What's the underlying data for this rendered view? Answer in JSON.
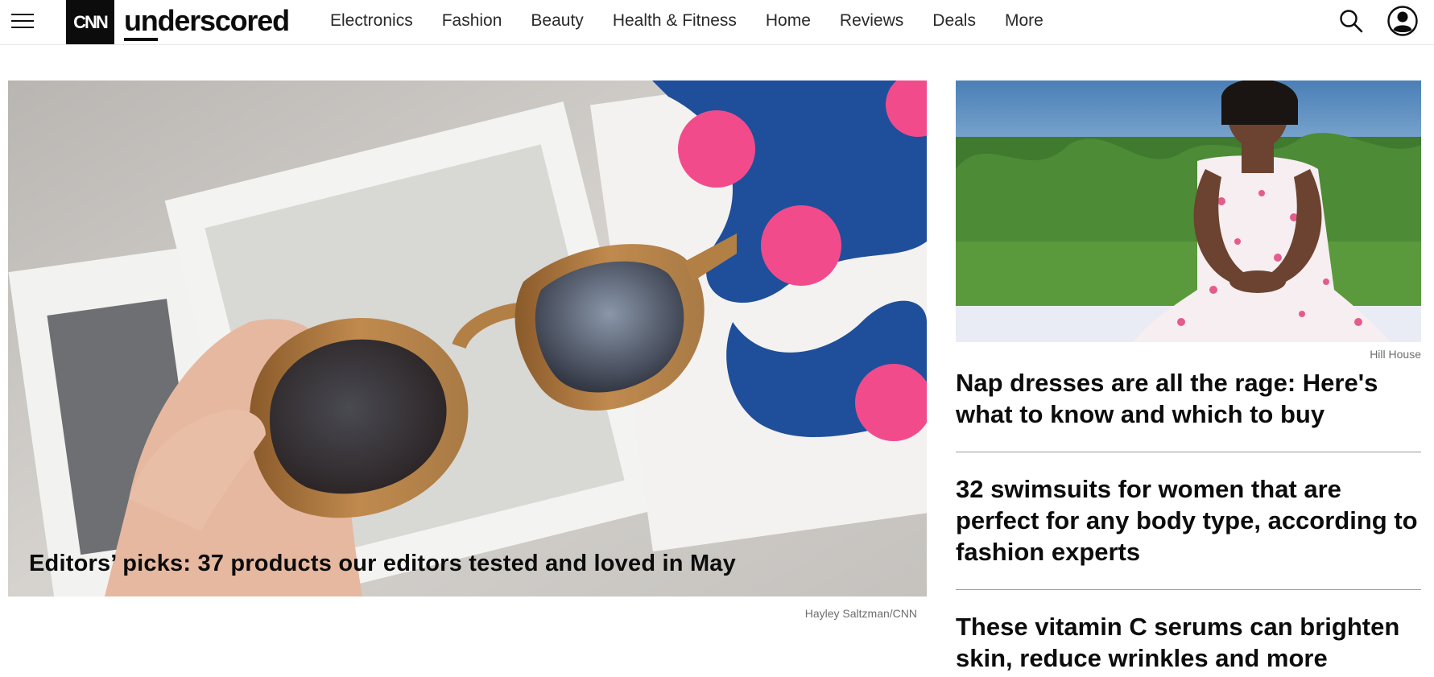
{
  "header": {
    "logo_cnn": "CNN",
    "logo_word": "underscored",
    "nav": [
      "Electronics",
      "Fashion",
      "Beauty",
      "Health & Fitness",
      "Home",
      "Reviews",
      "Deals",
      "More"
    ]
  },
  "hero": {
    "credit": "Hayley Saltzman/CNN",
    "title": "Editors’ picks: 37 products our editors tested and loved in May"
  },
  "side": {
    "credit": "Hill House",
    "headlines": [
      "Nap dresses are all the rage: Here's what to know and which to buy",
      "32 swimsuits for women that are perfect for any body type, according to fashion experts",
      "These vitamin C serums can brighten skin, reduce wrinkles and more"
    ]
  },
  "colors": {
    "text": "#0c0c0c",
    "muted": "#6e6e6e",
    "divider": "#9a9a9a",
    "logo_bg": "#0c0c0c"
  },
  "icons": [
    "menu-icon",
    "search-icon",
    "account-icon"
  ]
}
